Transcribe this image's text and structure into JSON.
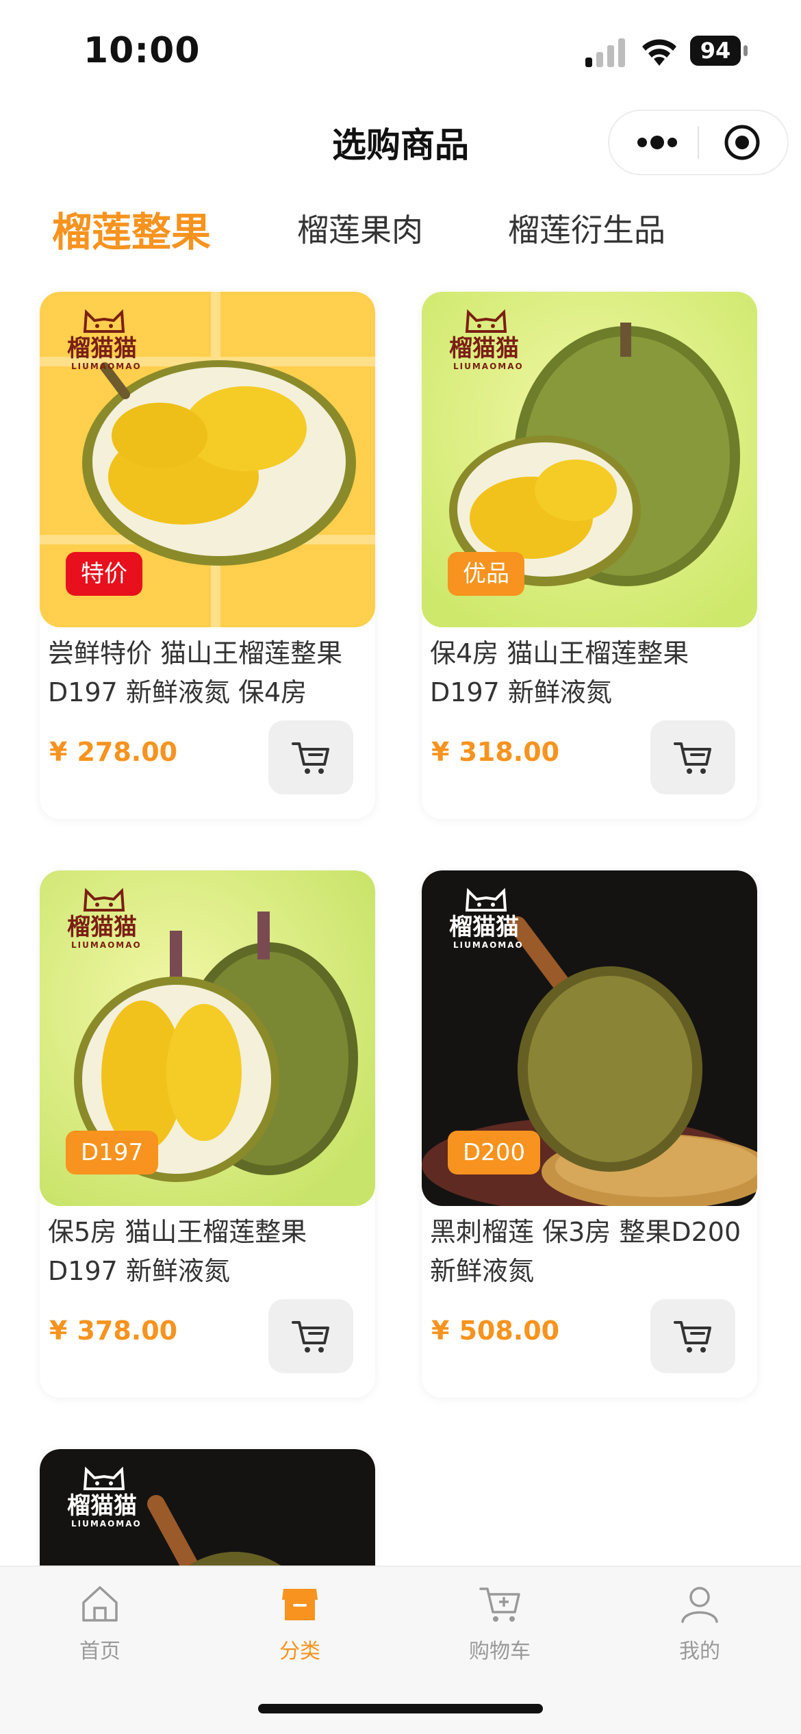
{
  "status_bar": {
    "time": "10:00",
    "battery": "94"
  },
  "header": {
    "title": "选购商品"
  },
  "tabs": [
    {
      "label": "榴莲整果",
      "active": true
    },
    {
      "label": "榴莲果肉",
      "active": false
    },
    {
      "label": "榴莲衍生品",
      "active": false
    }
  ],
  "brand": {
    "name": "榴猫猫",
    "sub": "LIUMAOMAO"
  },
  "products": [
    {
      "title": "尝鲜特价 猫山王榴莲整果D197 新鲜液氮 保4房",
      "currency": "¥",
      "price": "278.00",
      "badge": "特价",
      "badge_color": "#e8101c"
    },
    {
      "title": "保4房 猫山王榴莲整果D197 新鲜液氮",
      "currency": "¥",
      "price": "318.00",
      "badge": "优品",
      "badge_color": "#f7931e"
    },
    {
      "title": "保5房 猫山王榴莲整果D197 新鲜液氮",
      "currency": "¥",
      "price": "378.00",
      "badge": "D197",
      "badge_color": "#f7931e"
    },
    {
      "title": "黑刺榴莲 保3房 整果D200新鲜液氮",
      "currency": "¥",
      "price": "508.00",
      "badge": "D200",
      "badge_color": "#f7931e"
    }
  ],
  "tabbar": [
    {
      "label": "首页",
      "icon": "home-icon",
      "active": false
    },
    {
      "label": "分类",
      "icon": "shop-icon",
      "active": true
    },
    {
      "label": "购物车",
      "icon": "cart-icon",
      "active": false
    },
    {
      "label": "我的",
      "icon": "user-icon",
      "active": false
    }
  ],
  "colors": {
    "accent": "#f7931e",
    "sale_badge": "#e8101c",
    "price": "#f7931e",
    "inactive": "#999999"
  }
}
